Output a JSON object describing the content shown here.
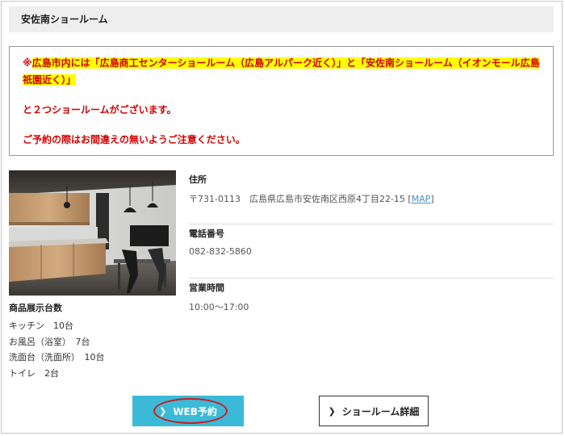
{
  "header": {
    "title": "安佐南ショールーム"
  },
  "notice": {
    "line1_prefix": "※",
    "line1_highlight": "広島市内には「広島商工センターショールーム（広島アルパーク近く）」と「安佐南ショールーム（イオンモール広島祇園近く）」",
    "line2": "と２つショールームがございます。",
    "line3": "ご予約の際はお間違えの無いようご注意ください。",
    "text_color": "#d40000",
    "highlight_color": "#ffff00"
  },
  "showroom": {
    "display_heading": "商品展示台数",
    "items": [
      {
        "name": "キッチン",
        "count": "10台"
      },
      {
        "name": "お風呂（浴室）",
        "count": "7台"
      },
      {
        "name": "洗面台（洗面所）",
        "count": "10台"
      },
      {
        "name": "トイレ",
        "count": "2台"
      }
    ]
  },
  "details": {
    "address_label": "住所",
    "address_value": "〒731-0113　広島県広島市安佐南区西原4丁目22-15",
    "map_bracket_open": "[",
    "map_link": "MAP",
    "map_bracket_close": "]",
    "phone_label": "電話番号",
    "phone_value": "082-832-5860",
    "hours_label": "営業時間",
    "hours_value": "10:00〜17:00"
  },
  "buttons": {
    "web_reserve": "WEB予約",
    "showroom_detail": "ショールーム詳細",
    "web_color": "#3bbad8"
  }
}
